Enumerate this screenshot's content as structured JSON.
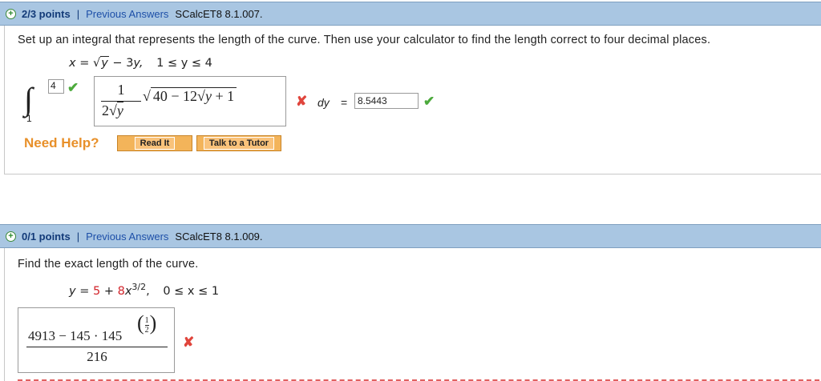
{
  "q1": {
    "points": "2/3 points",
    "separator": "|",
    "previous_answers": "Previous Answers",
    "code": "SCalcET8 8.1.007.",
    "prompt": "Set up an integral that represents the length of the curve. Then use your calculator to find the length correct to four decimal places.",
    "equation": {
      "lhs": "x",
      "eq": "=",
      "rad": "y",
      "minus": "−",
      "coef": "3",
      "var": "y,",
      "range": "1 ≤ y ≤ 4"
    },
    "integral": {
      "upper": "4",
      "lower": "1"
    },
    "integrand": {
      "num": "1",
      "den_coef": "2",
      "den_rad": "y",
      "rad_a": "40 − 12",
      "rad_inner": "y",
      "rad_b": "+ 1"
    },
    "dy_label": "dy",
    "dy_eq": "=",
    "length_value": "8.5443",
    "need_help": "Need Help?",
    "read_it": "Read It",
    "talk_tutor": "Talk to a Tutor"
  },
  "q2": {
    "points": "0/1 points",
    "separator": "|",
    "previous_answers": "Previous Answers",
    "code": "SCalcET8 8.1.009.",
    "prompt": "Find the exact length of the curve.",
    "equation": {
      "lhs": "y",
      "eq": "=",
      "c": "5",
      "plus": "+",
      "coef": "8",
      "var": "x",
      "exp": "3/2",
      "comma": ",",
      "range": "0 ≤ x ≤ 1"
    },
    "answer": {
      "num_a": "4913 − 145 · 145",
      "exp_num": "1",
      "exp_den": "2",
      "den": "216"
    }
  },
  "colors": {
    "header": "#a9c6e2",
    "check": "#4caa3c",
    "x": "#e0453c",
    "red": "#d2232a",
    "button": "#f3b45a"
  }
}
